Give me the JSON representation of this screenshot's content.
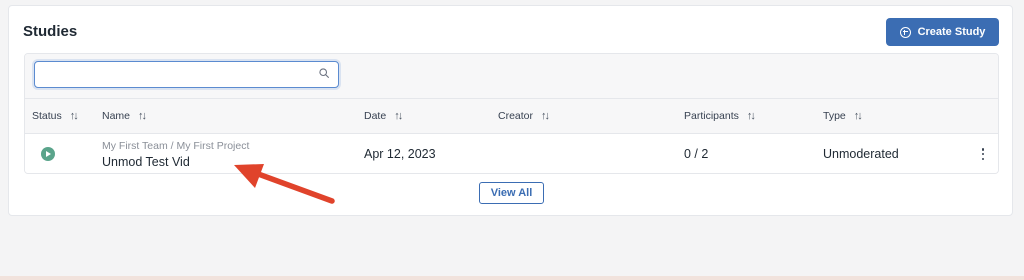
{
  "header": {
    "title": "Studies",
    "create_button_label": "Create Study"
  },
  "search": {
    "value": "",
    "placeholder": ""
  },
  "table": {
    "columns": {
      "status": "Status",
      "name": "Name",
      "date": "Date",
      "creator": "Creator",
      "participants": "Participants",
      "type": "Type"
    },
    "sort_glyph": "↑↓",
    "rows": [
      {
        "status": "play",
        "path": "My First Team / My First Project",
        "name": "Unmod Test Vid",
        "date": "Apr 12, 2023",
        "creator": "",
        "participants": "0 / 2",
        "type": "Unmoderated"
      }
    ]
  },
  "footer": {
    "view_all_label": "View All"
  },
  "colors": {
    "accent": "#3b6db3",
    "status_active": "#5aa48b",
    "annotation_arrow": "#e0432b"
  },
  "icons": {
    "create": "plus-circle-icon",
    "search": "search-icon",
    "sort": "sort-icon",
    "status": "play-circle-icon",
    "row_menu": "kebab-menu-icon"
  }
}
